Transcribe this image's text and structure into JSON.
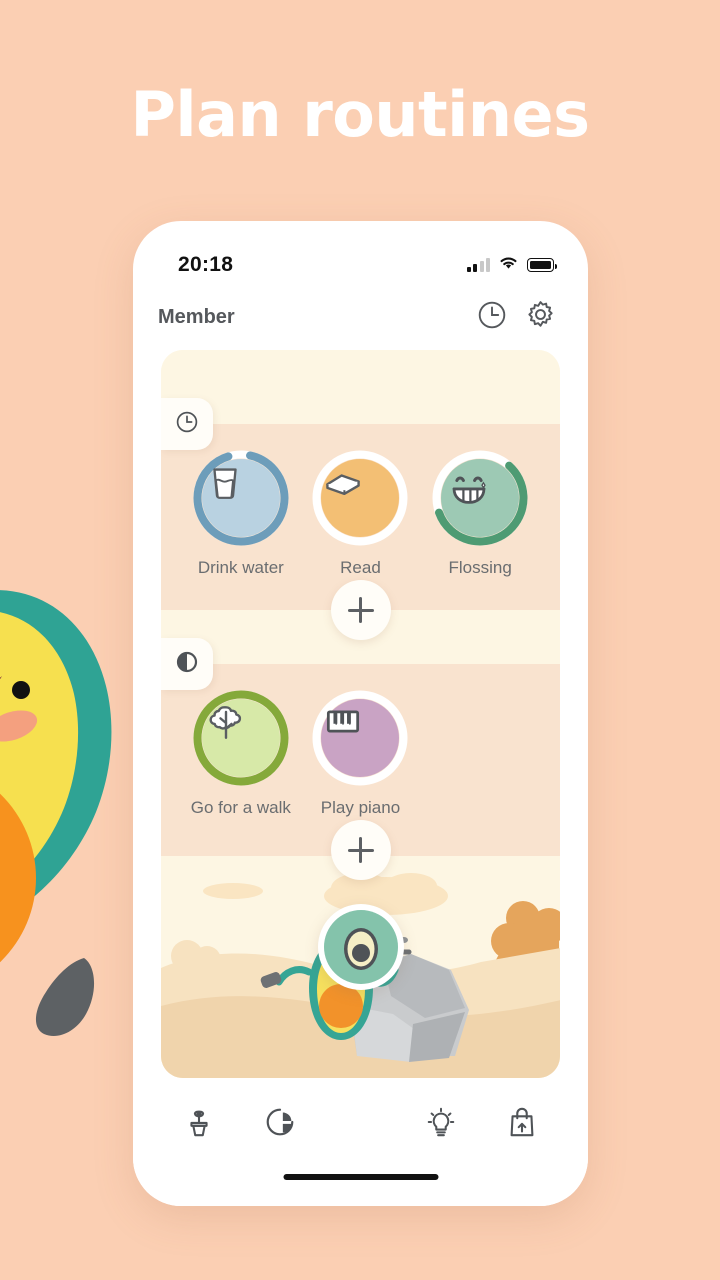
{
  "headline": "Plan routines",
  "colors": {
    "background": "#fbcfb3",
    "card_cream": "#fdf6e3",
    "section_peach": "#f9e3cf",
    "accent_green": "#84c3ab",
    "label_grey": "#6a6d70"
  },
  "phone": {
    "statusbar": {
      "time": "20:18",
      "icons": [
        "signal-icon",
        "wifi-icon",
        "battery-icon"
      ]
    },
    "appbar": {
      "title": "Member",
      "clock_icon": "clock-icon",
      "settings_icon": "gear-icon"
    },
    "sections": [
      {
        "tab_icon": "clock-icon",
        "tab_name": "morning-routine-tab",
        "habits": [
          {
            "label": "Drink water",
            "icon": "water-glass-icon",
            "disc_color": "#b9d2e1",
            "ring_color": "#6d9dba",
            "ring_percent": 92
          },
          {
            "label": "Read",
            "icon": "book-icon",
            "disc_color": "#f3bf74",
            "ring_color": "#ffffff",
            "ring_percent": 0
          },
          {
            "label": "Flossing",
            "icon": "teeth-smile-icon",
            "disc_color": "#9dc9b4",
            "ring_color": "#4e9b73",
            "ring_percent": 58
          }
        ],
        "add_button": "+"
      },
      {
        "tab_icon": "half-moon-icon",
        "tab_name": "evening-routine-tab",
        "habits": [
          {
            "label": "Go for a walk",
            "icon": "tree-icon",
            "disc_color": "#d7e9a8",
            "ring_color": "#85a93a",
            "ring_percent": 100
          },
          {
            "label": "Play piano",
            "icon": "piano-icon",
            "disc_color": "#c9a3c4",
            "ring_color": "#ffffff",
            "ring_percent": 0
          }
        ],
        "add_button": "+"
      }
    ],
    "scene": {
      "name": "avocado-mining-scene",
      "elements": [
        "avocado-character",
        "pickaxe",
        "hammer",
        "grey-rock",
        "clouds",
        "bushes"
      ]
    },
    "bottom_nav": [
      {
        "name": "nav-plant",
        "icon": "plant-pot-icon"
      },
      {
        "name": "nav-stats",
        "icon": "pie-chart-icon"
      },
      {
        "name": "nav-avocado",
        "icon": "avocado-icon"
      },
      {
        "name": "nav-ideas",
        "icon": "lightbulb-icon"
      },
      {
        "name": "nav-shop",
        "icon": "shopping-bag-icon"
      }
    ]
  },
  "mascot": {
    "name": "avocado-mascot",
    "icon": "avocado-character"
  }
}
